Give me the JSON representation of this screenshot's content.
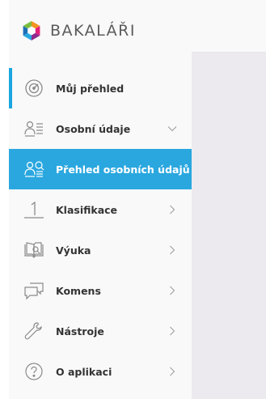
{
  "brand": {
    "name": "BAKALÁŘI",
    "logo_colors": [
      "#f2951f",
      "#e2207a",
      "#29a8e0",
      "#7bbe3f"
    ]
  },
  "colors": {
    "accent": "#2aa7df",
    "active_bar": "#1aa6df",
    "sidebar_bg": "#f9f9f9",
    "main_bg": "#eceaef",
    "text": "#333333"
  },
  "nav": {
    "items": [
      {
        "label": "Můj přehled",
        "icon": "dashboard-gauge-icon",
        "chevron": "none",
        "state": "active"
      },
      {
        "label": "Osobní údaje",
        "icon": "person-card-icon",
        "chevron": "down",
        "state": "expanded"
      },
      {
        "label": "Přehled osobních údajů",
        "icon": "person-overview-icon",
        "chevron": "none",
        "state": "selected"
      },
      {
        "label": "Klasifikace",
        "icon": "grade-one-icon",
        "chevron": "right",
        "state": "normal"
      },
      {
        "label": "Výuka",
        "icon": "book-search-icon",
        "chevron": "right",
        "state": "normal"
      },
      {
        "label": "Komens",
        "icon": "chat-bubbles-icon",
        "chevron": "right",
        "state": "normal"
      },
      {
        "label": "Nástroje",
        "icon": "wrench-icon",
        "chevron": "right",
        "state": "normal"
      },
      {
        "label": "O aplikaci",
        "icon": "question-circle-icon",
        "chevron": "right",
        "state": "normal"
      }
    ]
  }
}
